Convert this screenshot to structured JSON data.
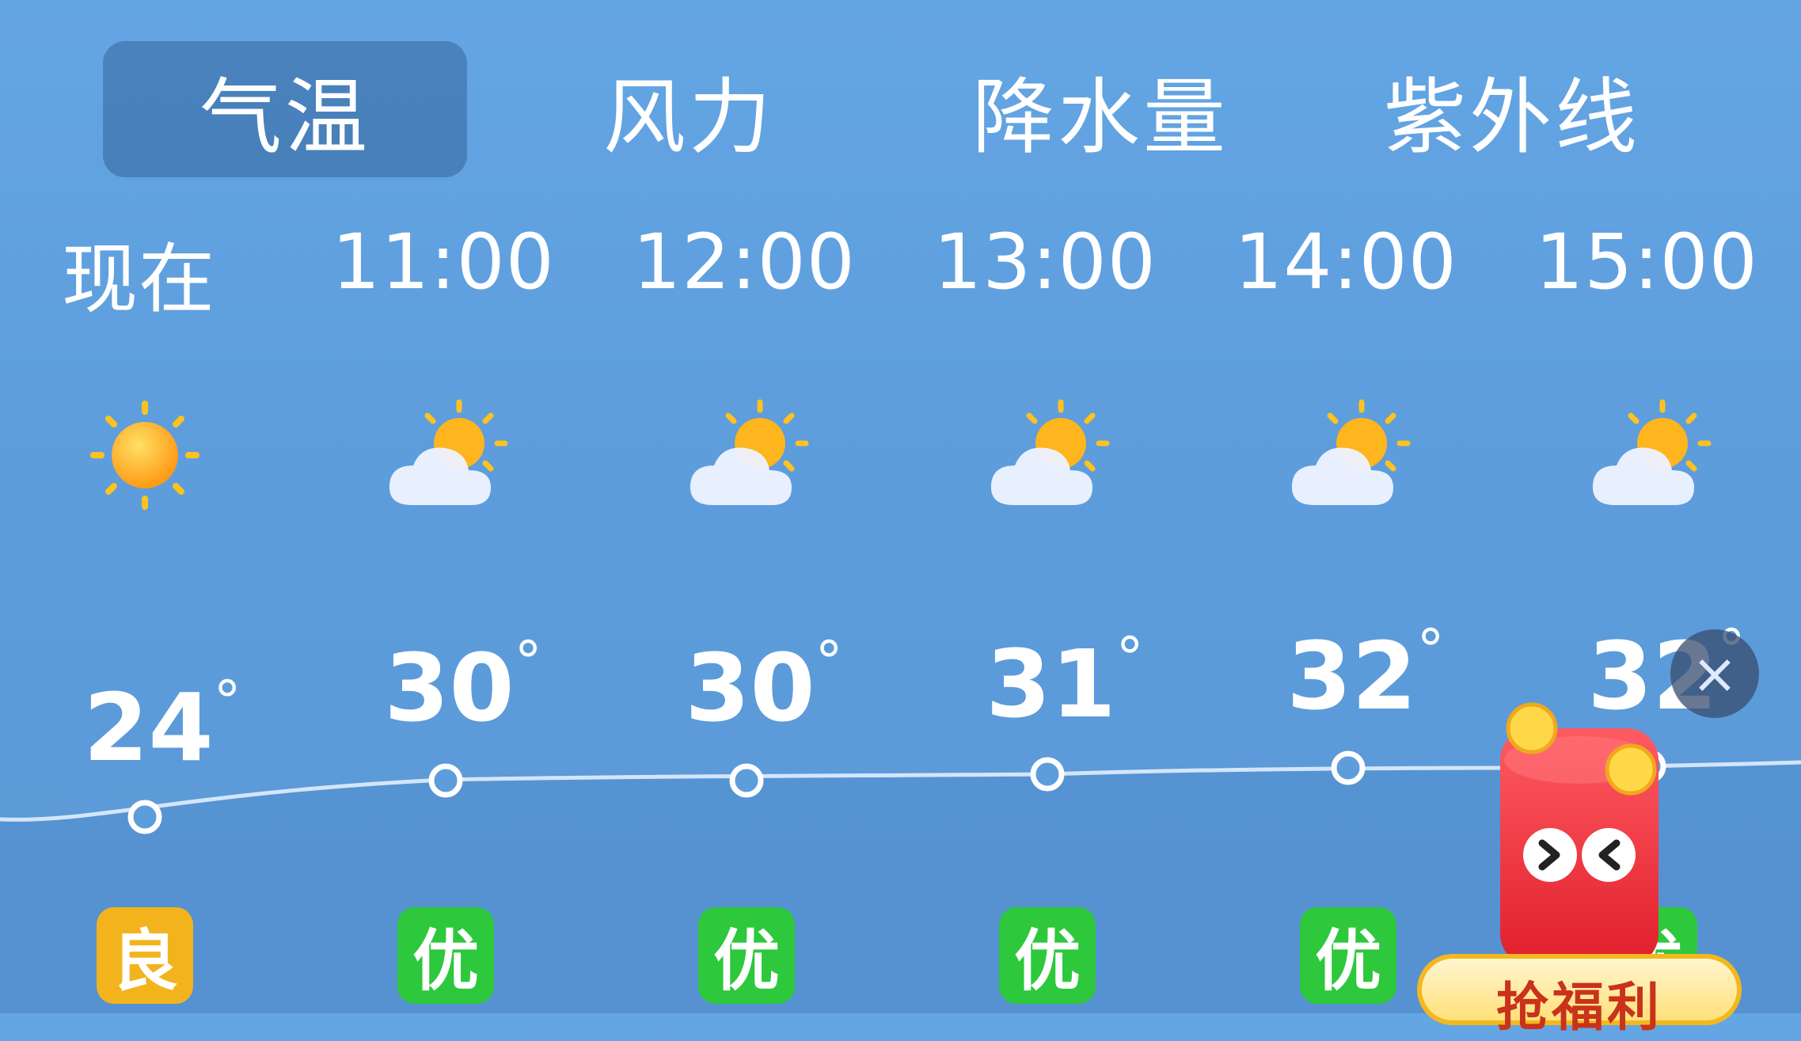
{
  "tabs": [
    {
      "label": "气温",
      "active": true
    },
    {
      "label": "风力",
      "active": false
    },
    {
      "label": "降水量",
      "active": false
    },
    {
      "label": "紫外线",
      "active": false
    }
  ],
  "hours": [
    {
      "time": "现在",
      "icon": "sun-icon",
      "temp": "24",
      "aqi": "良",
      "aqi_level": "fair"
    },
    {
      "time": "11:00",
      "icon": "partly-cloudy-icon",
      "temp": "30",
      "aqi": "优",
      "aqi_level": "good"
    },
    {
      "time": "12:00",
      "icon": "partly-cloudy-icon",
      "temp": "30",
      "aqi": "优",
      "aqi_level": "good"
    },
    {
      "time": "13:00",
      "icon": "partly-cloudy-icon",
      "temp": "31",
      "aqi": "优",
      "aqi_level": "good"
    },
    {
      "time": "14:00",
      "icon": "partly-cloudy-icon",
      "temp": "32",
      "aqi": "优",
      "aqi_level": "good"
    },
    {
      "time": "15:00",
      "icon": "partly-cloudy-icon",
      "temp": "32",
      "aqi": "优",
      "aqi_level": "good"
    }
  ],
  "degree_symbol": "°",
  "promo": {
    "label": "抢福利"
  },
  "close_symbol": "×",
  "colors": {
    "aqi_good": "#2dc83c",
    "aqi_fair": "#f2b31d",
    "promo_red": "#e8323a"
  }
}
